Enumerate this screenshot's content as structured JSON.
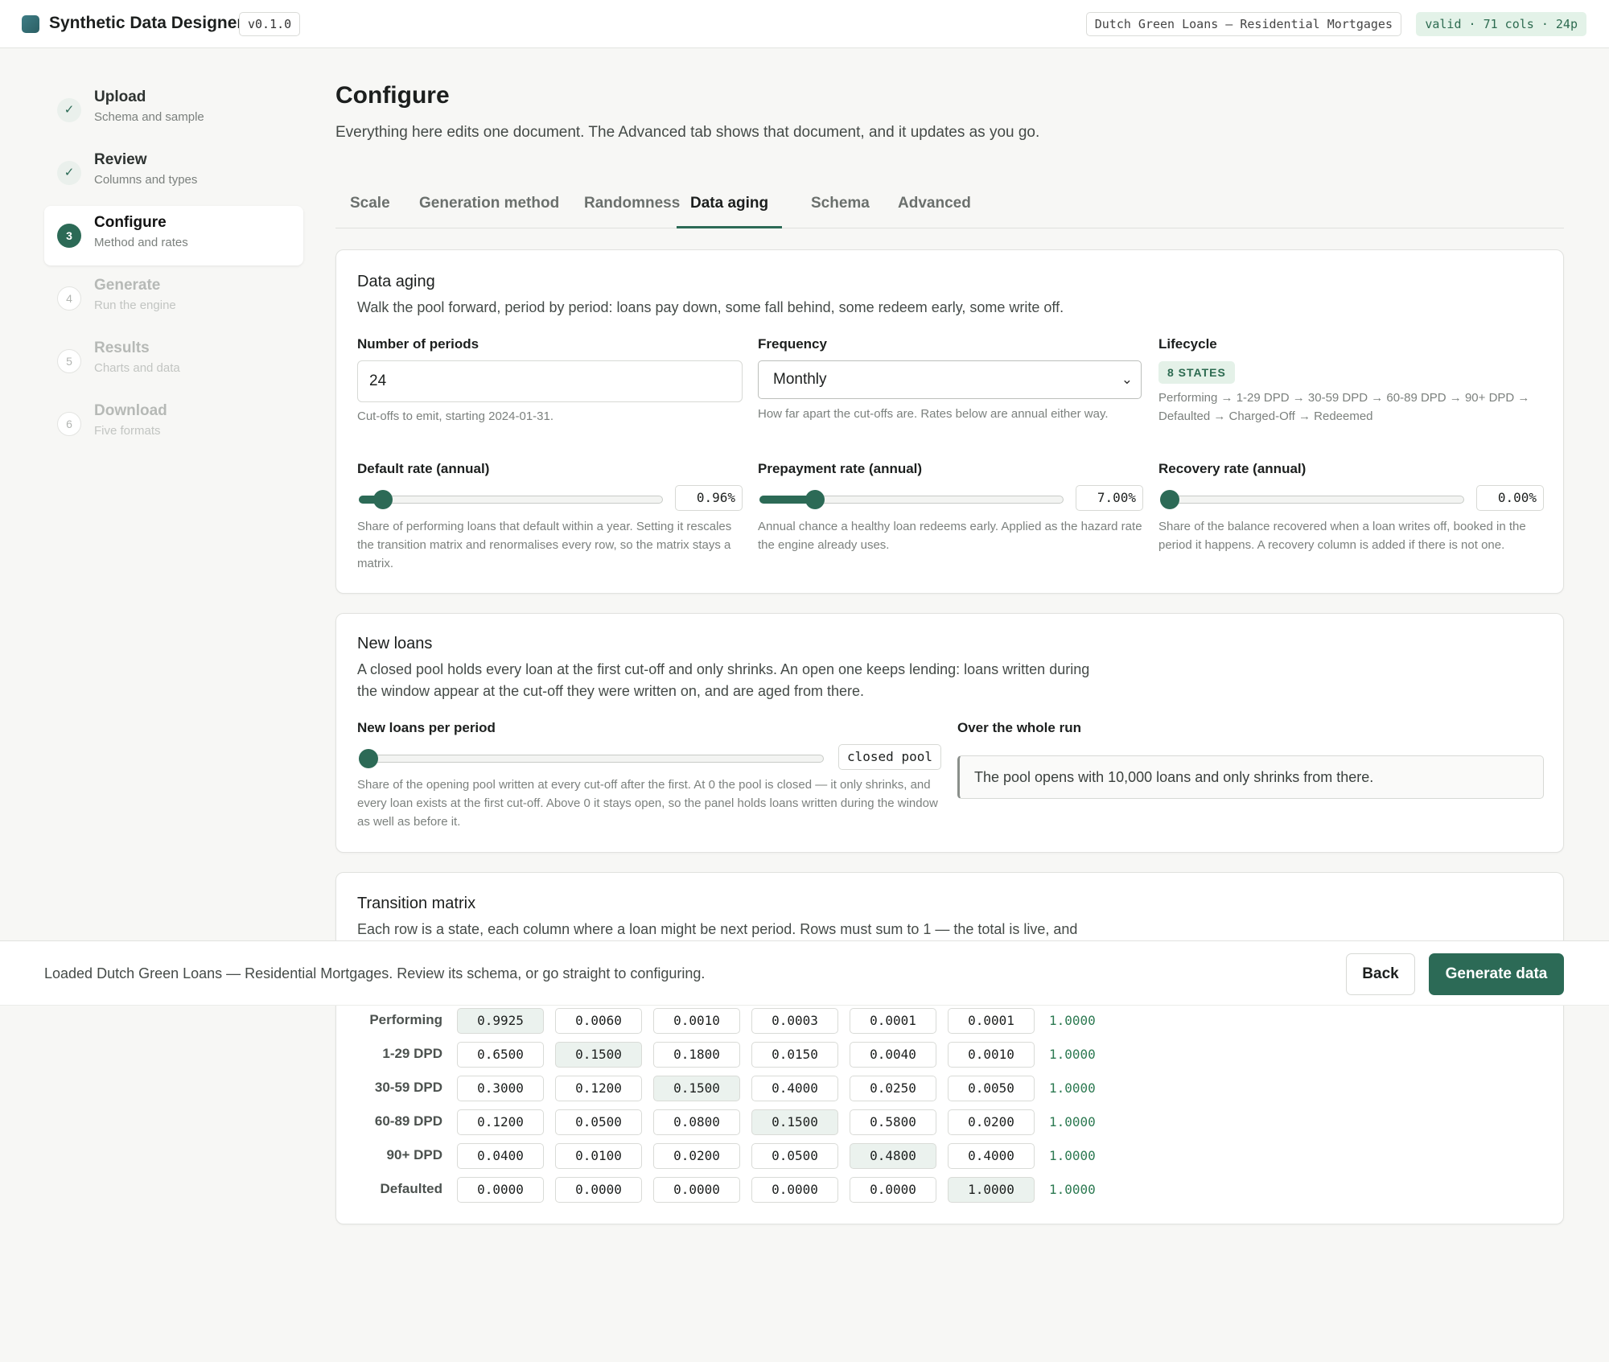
{
  "header": {
    "title": "Synthetic Data Designer",
    "version": "v0.1.0",
    "dataset": "Dutch Green Loans — Residential Mortgages",
    "status": "valid · 71 cols · 24p"
  },
  "steps": [
    {
      "num": "✓",
      "title": "Upload",
      "sub": "Schema and sample",
      "state": "done"
    },
    {
      "num": "✓",
      "title": "Review",
      "sub": "Columns and types",
      "state": "done"
    },
    {
      "num": "3",
      "title": "Configure",
      "sub": "Method and rates",
      "state": "current"
    },
    {
      "num": "4",
      "title": "Generate",
      "sub": "Run the engine",
      "state": "todo"
    },
    {
      "num": "5",
      "title": "Results",
      "sub": "Charts and data",
      "state": "todo"
    },
    {
      "num": "6",
      "title": "Download",
      "sub": "Five formats",
      "state": "todo"
    }
  ],
  "main": {
    "title": "Configure",
    "description": "Everything here edits one document. The Advanced tab shows that document, and it updates as you go.",
    "tabs": [
      "Scale",
      "Generation method",
      "Randomness",
      "Data aging",
      "Schema",
      "Advanced"
    ],
    "active_tab": "Data aging"
  },
  "aging": {
    "title": "Data aging",
    "description": "Walk the pool forward, period by period: loans pay down, some fall behind, some redeem early, some write off.",
    "periods_label": "Number of periods",
    "periods_value": "24",
    "periods_help": "Cut-offs to emit, starting 2024-01-31.",
    "frequency_label": "Frequency",
    "frequency_value": "Monthly",
    "frequency_help": "How far apart the cut-offs are. Rates below are annual either way.",
    "lifecycle_label": "Lifecycle",
    "lifecycle_chip": "8 STATES",
    "lifecycle_text": "Performing → 1-29 DPD → 30-59 DPD → 60-89 DPD → 90+ DPD → Defaulted → Charged-Off → Redeemed",
    "default_label": "Default rate (annual)",
    "default_value": "0.96%",
    "default_fraction": 0.05,
    "default_help": "Share of performing loans that default within a year. Setting it rescales the transition matrix and renormalises every row, so the matrix stays a matrix.",
    "prepay_label": "Prepayment rate (annual)",
    "prepay_value": "7.00%",
    "prepay_fraction": 0.16,
    "prepay_help": "Annual chance a healthy loan redeems early. Applied as the hazard rate the engine already uses.",
    "recovery_label": "Recovery rate (annual)",
    "recovery_value": "0.00%",
    "recovery_fraction": 0.0,
    "recovery_help": "Share of the balance recovered when a loan writes off, booked in the period it happens. A recovery column is added if there is not one."
  },
  "new_loans": {
    "title": "New loans",
    "description": "A closed pool holds every loan at the first cut-off and only shrinks. An open one keeps lending: loans written during the window appear at the cut-off they were written on, and are aged from there.",
    "per_period_label": "New loans per period",
    "per_period_value": "closed pool",
    "per_period_fraction": 0.0,
    "per_period_help": "Share of the opening pool written at every cut-off after the first. At 0 the pool is closed — it only shrinks, and every loan exists at the first cut-off. Above 0 it stays open, so the panel holds loans written during the window as well as before it.",
    "run_label": "Over the whole run",
    "run_text": "The pool opens with 10,000 loans and only shrinks from there."
  },
  "matrix": {
    "title": "Transition matrix",
    "description": "Each row is a state, each column where a loan might be next period. Rows must sum to 1 — the total is live, and",
    "rows": [
      {
        "label": "Performing",
        "cells": [
          "0.9925",
          "0.0060",
          "0.0010",
          "0.0003",
          "0.0001",
          "0.0001"
        ],
        "sum": "1.0000"
      },
      {
        "label": "1-29 DPD",
        "cells": [
          "0.6500",
          "0.1500",
          "0.1800",
          "0.0150",
          "0.0040",
          "0.0010"
        ],
        "sum": "1.0000"
      },
      {
        "label": "30-59 DPD",
        "cells": [
          "0.3000",
          "0.1200",
          "0.1500",
          "0.4000",
          "0.0250",
          "0.0050"
        ],
        "sum": "1.0000"
      },
      {
        "label": "60-89 DPD",
        "cells": [
          "0.1200",
          "0.0500",
          "0.0800",
          "0.1500",
          "0.5800",
          "0.0200"
        ],
        "sum": "1.0000"
      },
      {
        "label": "90+ DPD",
        "cells": [
          "0.0400",
          "0.0100",
          "0.0200",
          "0.0500",
          "0.4800",
          "0.4000"
        ],
        "sum": "1.0000"
      },
      {
        "label": "Defaulted",
        "cells": [
          "0.0000",
          "0.0000",
          "0.0000",
          "0.0000",
          "0.0000",
          "1.0000"
        ],
        "sum": "1.0000"
      }
    ]
  },
  "footer": {
    "message": "Loaded Dutch Green Loans — Residential Mortgages. Review its schema, or go straight to configuring.",
    "back_label": "Back",
    "generate_label": "Generate data"
  }
}
